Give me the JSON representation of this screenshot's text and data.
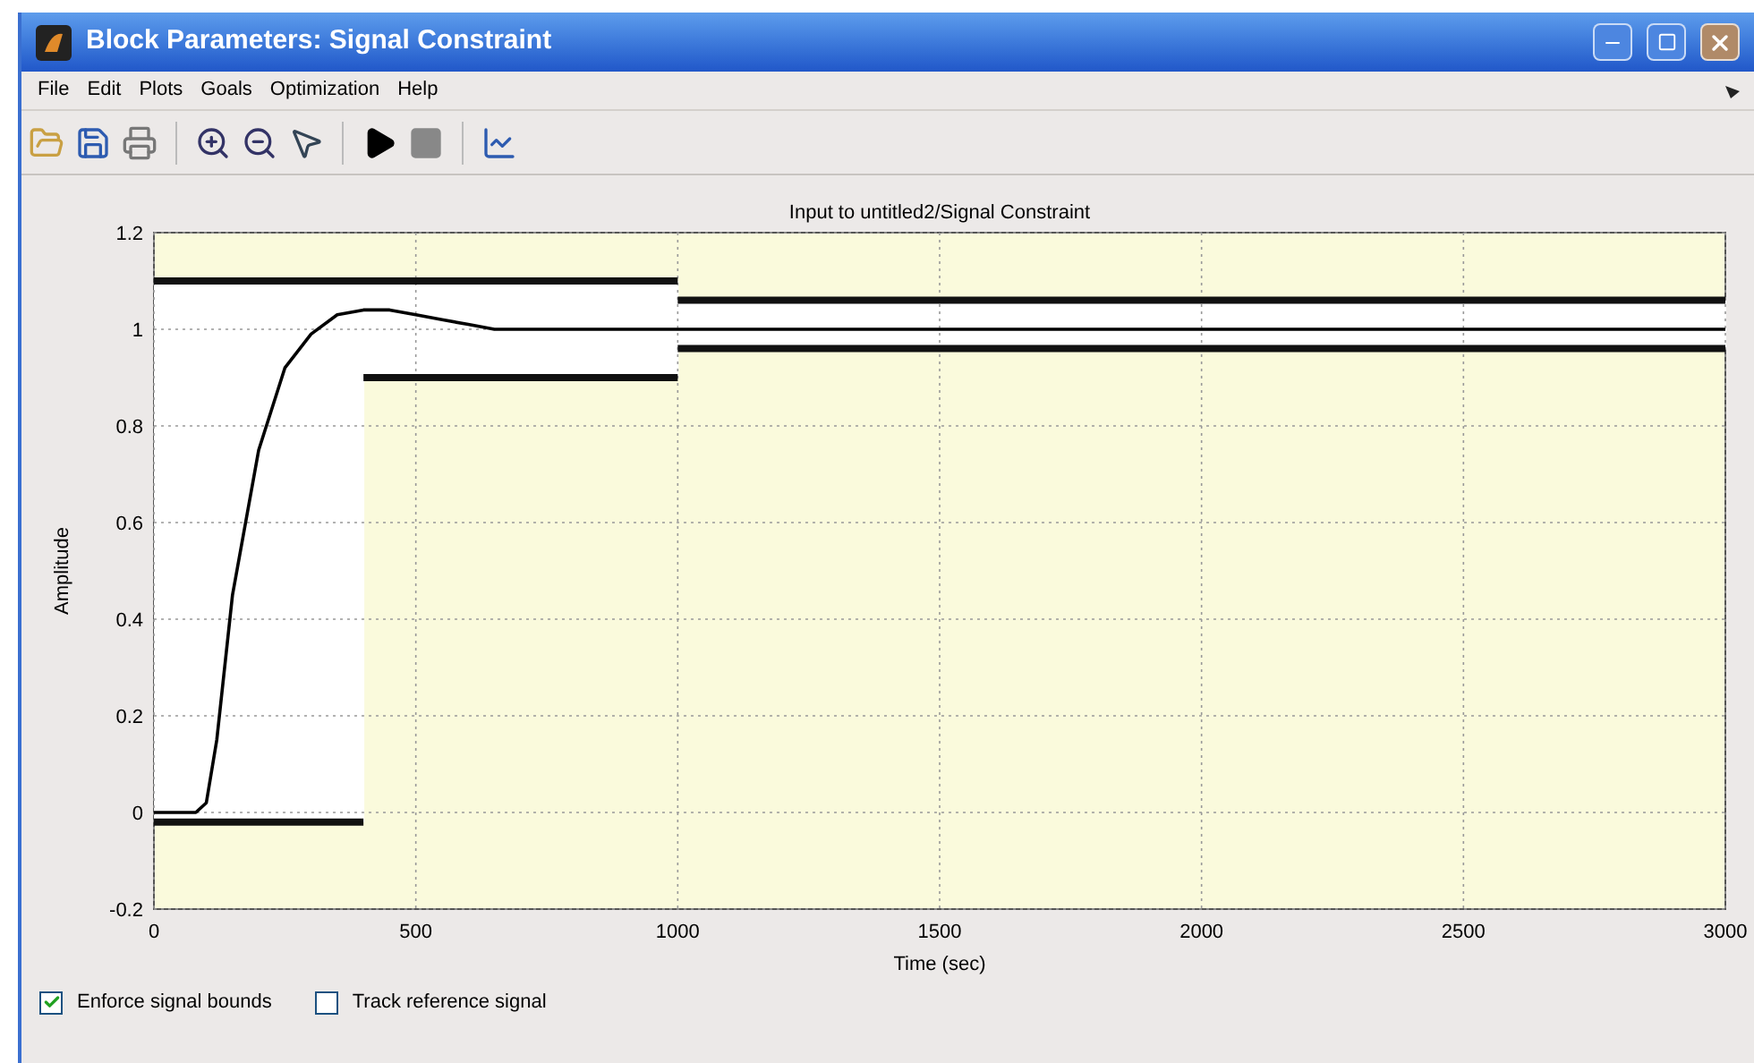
{
  "window": {
    "title": "Block Parameters: Signal Constraint"
  },
  "menu": [
    "File",
    "Edit",
    "Plots",
    "Goals",
    "Optimization",
    "Help"
  ],
  "plot": {
    "chart_data": {
      "type": "line",
      "title": "Input to untitled2/Signal Constraint",
      "xlabel": "Time (sec)",
      "ylabel": "Amplitude",
      "grid": true,
      "x": [
        0,
        80,
        100,
        120,
        150,
        200,
        250,
        300,
        350,
        400,
        450,
        500,
        550,
        600,
        650,
        700,
        1000,
        3000
      ],
      "series": [
        {
          "color": "#000000",
          "values": [
            0,
            0,
            0.02,
            0.15,
            0.45,
            0.75,
            0.92,
            0.99,
            1.03,
            1.04,
            1.04,
            1.03,
            1.02,
            1.01,
            1.0,
            1.0,
            1.0,
            1.0
          ]
        },
        {
          "color": "#111111",
          "values": [
            1.1,
            1.1,
            1.1,
            1.1,
            1.1,
            1.1,
            1.1,
            1.1,
            1.1,
            1.1,
            1.1,
            1.1,
            1.1,
            1.1,
            1.1,
            1.1,
            1.1,
            null
          ]
        },
        {
          "color": "#111111",
          "values": [
            null,
            null,
            null,
            null,
            null,
            null,
            null,
            null,
            null,
            null,
            null,
            null,
            null,
            null,
            null,
            null,
            1.06,
            1.06
          ]
        },
        {
          "color": "#111111",
          "values": [
            -0.02,
            -0.02,
            -0.02,
            -0.02,
            -0.02,
            -0.02,
            -0.02,
            -0.02,
            -0.02,
            -0.02,
            null,
            null,
            null,
            null,
            null,
            null,
            null,
            null
          ]
        },
        {
          "color": "#111111",
          "values": [
            null,
            null,
            null,
            null,
            null,
            null,
            null,
            null,
            null,
            0.9,
            0.9,
            0.9,
            0.9,
            0.9,
            0.9,
            0.9,
            0.9,
            null
          ]
        },
        {
          "color": "#111111",
          "values": [
            null,
            null,
            null,
            null,
            null,
            null,
            null,
            null,
            null,
            null,
            null,
            null,
            null,
            null,
            null,
            null,
            0.96,
            0.96
          ]
        }
      ],
      "xlim": [
        0,
        3000
      ],
      "ylim": [
        -0.2,
        1.2
      ],
      "xticks": [
        0,
        500,
        1000,
        1500,
        2000,
        2500,
        3000
      ],
      "yticks": [
        -0.2,
        0,
        0.2,
        0.4,
        0.6,
        0.8,
        1,
        1.2
      ]
    }
  },
  "options": [
    {
      "label": "Enforce signal bounds",
      "checked": true
    },
    {
      "label": "Track reference signal",
      "checked": false
    }
  ]
}
